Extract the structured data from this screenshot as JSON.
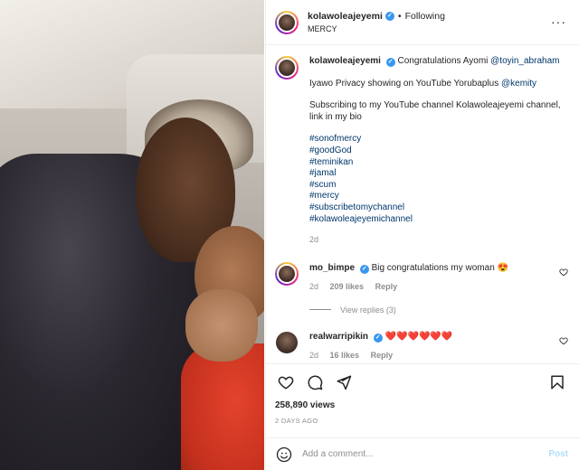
{
  "header": {
    "username": "kolawoleajeyemi",
    "separator": "•",
    "follow_status": "Following",
    "subtitle": "MERCY"
  },
  "caption": {
    "username": "kolawoleajeyemi",
    "line1_text": "Congratulations Ayomi ",
    "line1_mention": "@toyin_abraham",
    "line2_text": "Iyawo Privacy showing on YouTube Yorubaplus ",
    "line2_mention": "@kemity",
    "line3_text": "Subscribing to my YouTube channel Kolawoleajeyemi channel, link in my bio",
    "hashtags": [
      "#sonofmercy",
      "#goodGod",
      "#teminikan",
      "#jamal",
      "#scum",
      "#mercy",
      "#subscribetomychannel",
      "#kolawoleajeyemichannel"
    ],
    "age": "2d"
  },
  "comments": [
    {
      "username": "mo_bimpe",
      "text": "Big congratulations my woman ",
      "emoji": "😍",
      "age": "2d",
      "likes": "209 likes",
      "reply": "Reply",
      "view_replies": "View replies (3)"
    },
    {
      "username": "realwarripikin",
      "text": "",
      "emoji": "❤️❤️❤️❤️❤️❤️",
      "age": "2d",
      "likes": "16 likes",
      "reply": "Reply"
    }
  ],
  "icons": {
    "verified": "verified-badge-icon",
    "like": "heart-icon",
    "comment": "comment-bubble-icon",
    "share": "paper-plane-icon",
    "save": "bookmark-icon",
    "emoji": "smiley-icon",
    "more": "more-options-icon"
  },
  "stats": {
    "views": "258,890 views",
    "date": "2 DAYS AGO"
  },
  "add_comment": {
    "placeholder": "Add a comment...",
    "post_label": "Post"
  },
  "colors": {
    "link": "#00376b",
    "verified": "#3897f0",
    "post_disabled": "#b2dffc"
  }
}
